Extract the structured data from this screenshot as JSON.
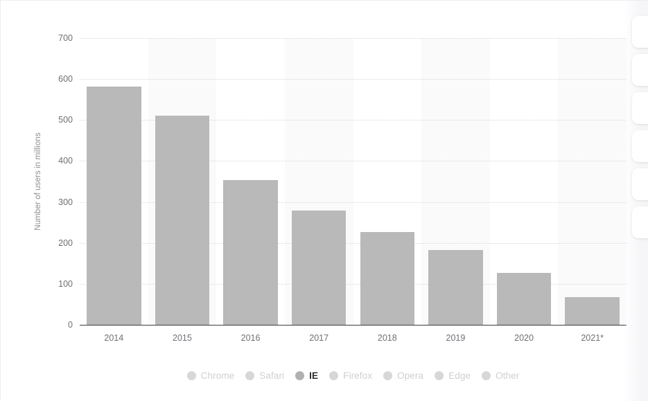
{
  "chart_data": {
    "type": "bar",
    "title": "",
    "subtitle": "",
    "xlabel": "",
    "ylabel": "Number of users in millions",
    "categories": [
      "2014",
      "2015",
      "2016",
      "2017",
      "2018",
      "2019",
      "2020",
      "2021*"
    ],
    "values": [
      582,
      511,
      354,
      279,
      226,
      183,
      126,
      67
    ],
    "series": [
      {
        "name": "IE",
        "values": [
          582,
          511,
          354,
          279,
          226,
          183,
          126,
          67
        ]
      }
    ],
    "ylim": [
      0,
      700
    ],
    "ytick_labels": [
      "700",
      "600",
      "500",
      "400",
      "300",
      "200",
      "100",
      "0"
    ],
    "ytick_values": [
      700,
      600,
      500,
      400,
      300,
      200,
      100,
      0
    ],
    "grid": true,
    "legend_position": "bottom",
    "bar_color": "#b9b9b9",
    "legend": [
      {
        "label": "Chrome",
        "active": false
      },
      {
        "label": "Safari",
        "active": false
      },
      {
        "label": "IE",
        "active": true
      },
      {
        "label": "Firefox",
        "active": false
      },
      {
        "label": "Opera",
        "active": false
      },
      {
        "label": "Edge",
        "active": false
      },
      {
        "label": "Other",
        "active": false
      }
    ]
  },
  "side_panel": {
    "cards": [
      {
        "name": "side-card-1"
      },
      {
        "name": "side-card-2"
      },
      {
        "name": "side-card-3"
      },
      {
        "name": "side-card-4"
      },
      {
        "name": "side-card-5"
      },
      {
        "name": "side-card-6"
      }
    ]
  },
  "colors": {
    "bar": "#b9b9b9",
    "band": "#fafafa",
    "grid": "#d8d8dc",
    "axis": "#3c3c3c",
    "tick_text": "#6f6f75",
    "legend_inactive": "#cfcfd2",
    "legend_active": "#2b2b2e"
  }
}
